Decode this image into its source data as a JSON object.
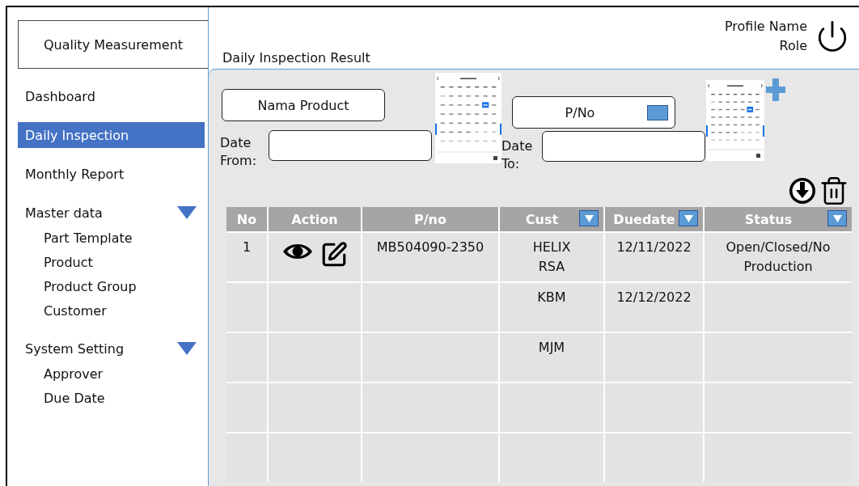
{
  "app": {
    "title": "Quality Measurement"
  },
  "sidebar": {
    "items": [
      {
        "label": "Dashboard",
        "selected": false
      },
      {
        "label": "Daily Inspection",
        "selected": true
      },
      {
        "label": "Monthly Report",
        "selected": false
      },
      {
        "label": "Master data",
        "selected": false,
        "expanded": true,
        "children": [
          {
            "label": "Part Template",
            "selected": false
          },
          {
            "label": "Product",
            "selected": false
          },
          {
            "label": "Product Group",
            "selected": false
          },
          {
            "label": "Customer",
            "selected": false
          }
        ]
      },
      {
        "label": "System Setting",
        "selected": false,
        "expanded": true,
        "children": [
          {
            "label": "Approver",
            "selected": false
          },
          {
            "label": "Due Date",
            "selected": false
          }
        ]
      }
    ]
  },
  "page": {
    "title": "Daily Inspection Result"
  },
  "profile": {
    "name": "Profile Name",
    "role": "Role"
  },
  "filters": {
    "product_button": "Nama Product",
    "date_from_label": "Date From:",
    "pno_field": {
      "placeholder": "P/No"
    },
    "date_to_label": "Date To:"
  },
  "table": {
    "columns": [
      {
        "label": "No",
        "filter": false
      },
      {
        "label": "Action",
        "filter": false
      },
      {
        "label": "P/no",
        "filter": false
      },
      {
        "label": "Cust",
        "filter": true
      },
      {
        "label": "Duedate",
        "filter": true
      },
      {
        "label": "Status",
        "filter": true
      }
    ],
    "rows": [
      {
        "no": "1",
        "actions": true,
        "pno": "MB504090-2350",
        "cust": [
          "HELIX",
          "RSA"
        ],
        "duedate": "12/11/2022",
        "status": "Open/Closed/No Production"
      },
      {
        "actions": false,
        "cust": [
          "KBM"
        ],
        "duedate": "12/12/2022"
      },
      {
        "actions": false,
        "cust": [
          "MJM"
        ]
      },
      {
        "actions": false
      },
      {
        "actions": false
      }
    ]
  }
}
